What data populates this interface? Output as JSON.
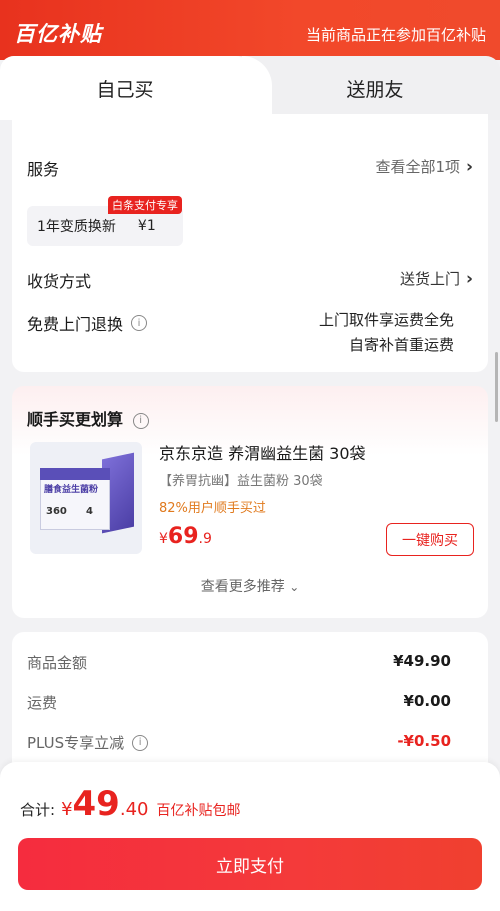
{
  "banner": {
    "logo": "百亿补贴",
    "note": "当前商品正在参加百亿补贴"
  },
  "tabs": [
    {
      "label": "自己买",
      "active": true
    },
    {
      "label": "送朋友",
      "active": false
    }
  ],
  "service": {
    "title": "服务",
    "view_all": "查看全部1项",
    "chip_name": "1年变质换新",
    "chip_price": "¥1",
    "chip_badge": "白条支付专享",
    "delivery_label": "收货方式",
    "delivery_value": "送货上门",
    "return_label": "免费上门退换",
    "return_line1": "上门取件享运费全免",
    "return_line2": "自寄补首重运费"
  },
  "recommend": {
    "title": "顺手买更划算",
    "product_name": "京东京造 养渭幽益生菌 30袋",
    "product_sub": "【养胃抗幽】益生菌粉 30袋",
    "bought": "82%用户顺手买过",
    "price_currency": "¥",
    "price_int": "69",
    "price_dec": ".9",
    "buy_label": "一键购买",
    "more_label": "查看更多推荐",
    "box_text": "膳食益生菌粉",
    "box_num": "360",
    "box_num2": "4"
  },
  "summary": {
    "rows": [
      {
        "label": "商品金额",
        "value": "¥49.90"
      },
      {
        "label": "运费",
        "value": "¥0.00"
      },
      {
        "label": "PLUS专享立减",
        "value": "-¥0.50"
      }
    ]
  },
  "bottom": {
    "total_label": "合计:",
    "currency": "¥",
    "total_int": "49",
    "total_dec": ".40",
    "note": "百亿补贴包邮",
    "pay_label": "立即支付"
  },
  "colors": {
    "accent": "#e8231f",
    "banner": "#ef3f24",
    "orange": "#e07a1e"
  }
}
